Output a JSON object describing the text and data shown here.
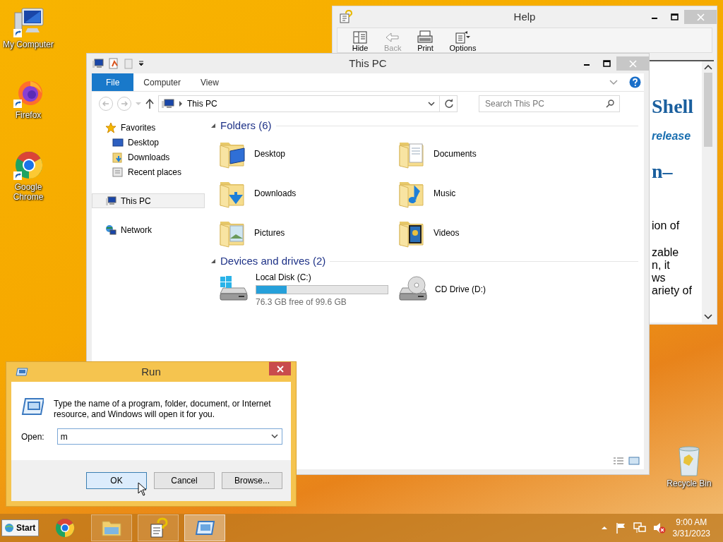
{
  "desktop_icons": [
    {
      "label": "My Computer",
      "kind": "computer"
    },
    {
      "label": "Firefox",
      "kind": "firefox"
    },
    {
      "label": "Google Chrome",
      "kind": "chrome"
    },
    {
      "label": "Recycle Bin",
      "kind": "recycle"
    }
  ],
  "help_window": {
    "title": "Help",
    "toolbar": [
      {
        "label": "Hide",
        "kind": "hide",
        "disabled": false
      },
      {
        "label": "Back",
        "kind": "back",
        "disabled": true
      },
      {
        "label": "Print",
        "kind": "print",
        "disabled": false
      },
      {
        "label": "Options",
        "kind": "options",
        "disabled": false
      }
    ],
    "content": [
      {
        "kind": "heading",
        "lines": [
          "Shell"
        ]
      },
      {
        "kind": "subheading",
        "lines": [
          "release"
        ]
      },
      {
        "kind": "heading",
        "lines": [
          "n–"
        ]
      },
      {
        "kind": "paragraph",
        "lines": [
          "ion of"
        ]
      },
      {
        "kind": "paragraph",
        "lines": [
          "zable",
          "n, it",
          "ws",
          "ariety of"
        ]
      }
    ]
  },
  "explorer": {
    "title": "This PC",
    "ribbon_tabs": [
      {
        "label": "File",
        "selected": true
      },
      {
        "label": "Computer",
        "selected": false
      },
      {
        "label": "View",
        "selected": false
      }
    ],
    "address": "This PC",
    "search": {
      "placeholder": "Search This PC"
    },
    "nav": [
      {
        "label": "Favorites",
        "kind": "star",
        "selected": false,
        "children": [
          {
            "label": "Desktop",
            "kind": "desktop",
            "selected": false
          },
          {
            "label": "Downloads",
            "kind": "downloads",
            "selected": false
          },
          {
            "label": "Recent places",
            "kind": "recent",
            "selected": false
          }
        ]
      },
      {
        "label": "This PC",
        "kind": "pc",
        "selected": true
      },
      {
        "label": "Network",
        "kind": "network",
        "selected": false
      }
    ],
    "folders": {
      "title": "Folders (6)",
      "items": [
        {
          "label": "Desktop",
          "kind": "desktop"
        },
        {
          "label": "Documents",
          "kind": "documents"
        },
        {
          "label": "Downloads",
          "kind": "downloads"
        },
        {
          "label": "Music",
          "kind": "music"
        },
        {
          "label": "Pictures",
          "kind": "pictures"
        },
        {
          "label": "Videos",
          "kind": "videos"
        }
      ]
    },
    "devices": {
      "title": "Devices and drives (2)",
      "items": [
        {
          "label": "Local Disk (C:)",
          "kind": "disk",
          "level": 0.23,
          "free": "76.3 GB free of 99.6 GB"
        },
        {
          "label": "CD Drive (D:)",
          "kind": "cd"
        }
      ]
    }
  },
  "run_dialog": {
    "title": "Run",
    "message": "Type the name of a program, folder, document, or Internet resource, and Windows will open it for you.",
    "open_label": "Open:",
    "value": "m",
    "buttons": [
      {
        "label": "OK",
        "default": true
      },
      {
        "label": "Cancel",
        "default": false
      },
      {
        "label": "Browse...",
        "default": false
      }
    ]
  },
  "taskbar": {
    "start": "Start",
    "apps": [
      {
        "kind": "chrome",
        "selected": false
      },
      {
        "kind": "explorer",
        "selected": false
      },
      {
        "kind": "help",
        "selected": false
      },
      {
        "kind": "run",
        "selected": true
      }
    ],
    "time": "9:00 AM",
    "date": "3/31/2023"
  }
}
